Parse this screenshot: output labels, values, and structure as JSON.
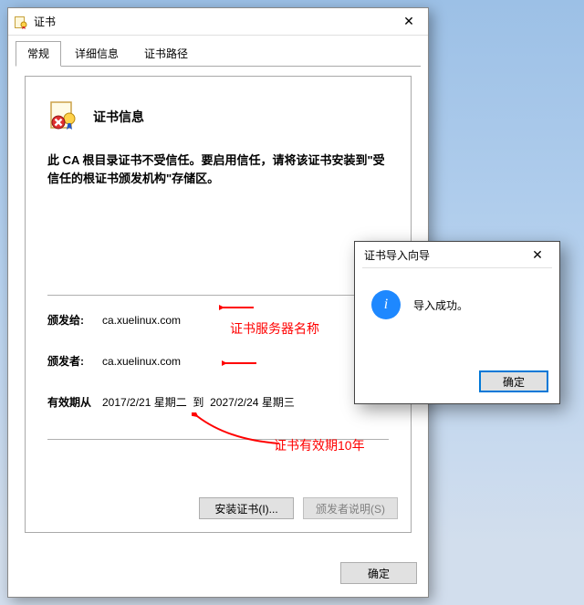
{
  "dialog": {
    "title": "证书",
    "tabs": [
      "常规",
      "详细信息",
      "证书路径"
    ],
    "activeTab": 0,
    "header": "证书信息",
    "warning": "此 CA 根目录证书不受信任。要启用信任，请将该证书安装到\"受信任的根证书颁发机构\"存储区。",
    "fields": {
      "issuedToLabel": "颁发给:",
      "issuedTo": "ca.xuelinux.com",
      "issuedByLabel": "颁发者:",
      "issuedBy": "ca.xuelinux.com",
      "validLabel": "有效期从",
      "validFrom": "2017/2/21 星期二",
      "toWord": "到",
      "validTo": "2027/2/24 星期三"
    },
    "buttons": {
      "install": "安装证书(I)...",
      "issuerStatement": "颁发者说明(S)",
      "ok": "确定"
    }
  },
  "popup": {
    "title": "证书导入向导",
    "message": "导入成功。",
    "ok": "确定"
  },
  "annotations": {
    "serverName": "证书服务器名称",
    "validity10y": "证书有效期10年"
  }
}
